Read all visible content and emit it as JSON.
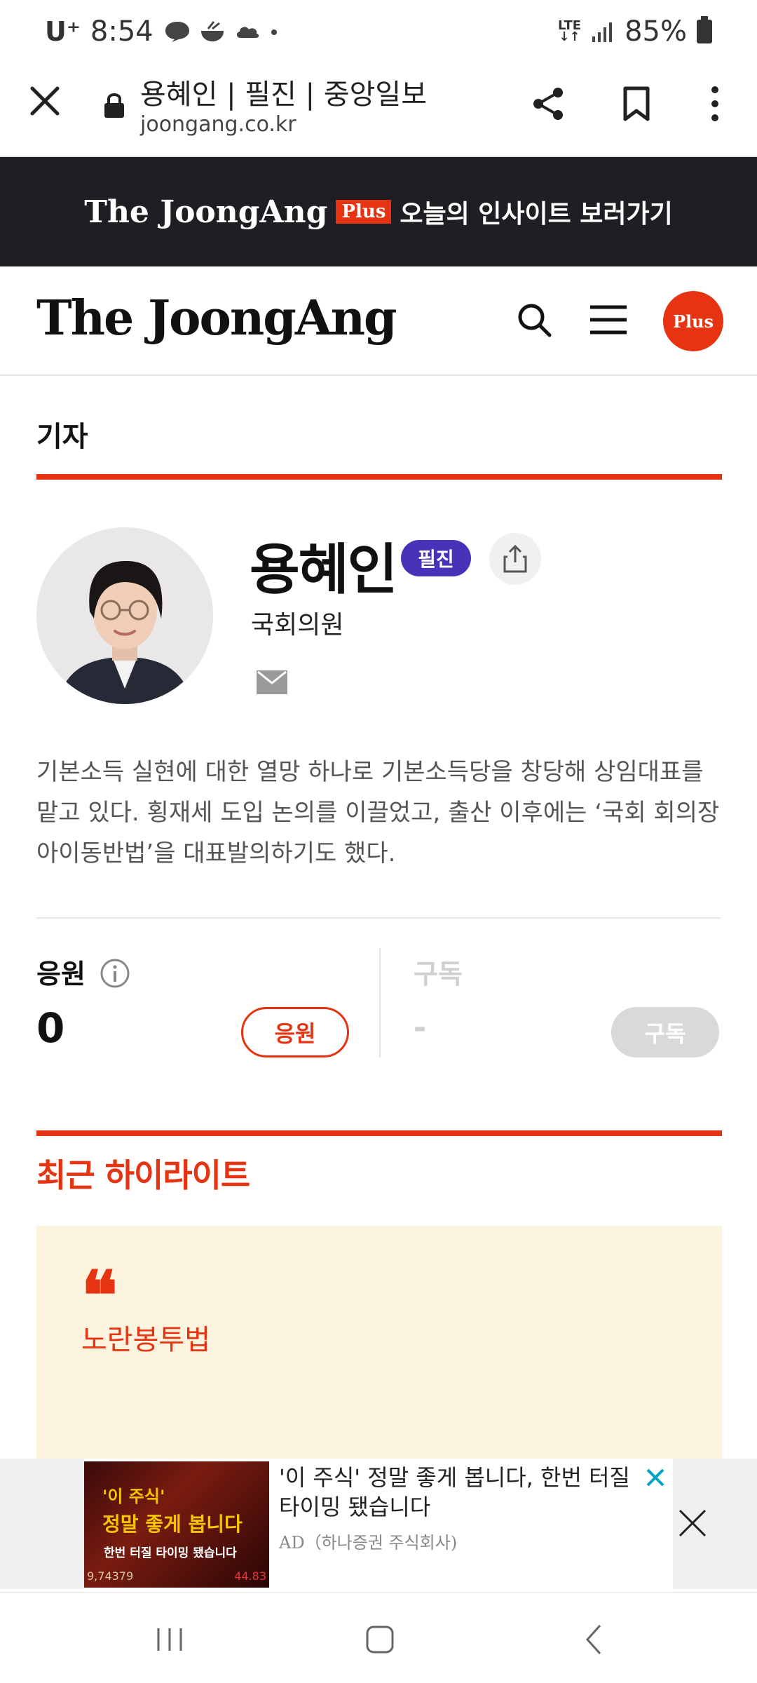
{
  "status_bar": {
    "carrier": "U⁺",
    "time": "8:54",
    "network": "LTE",
    "battery": "85%"
  },
  "browser": {
    "page_title": "용혜인 | 필진 | 중앙일보",
    "url": "joongang.co.kr"
  },
  "promo_banner": {
    "logo": "The JoongAng",
    "plus_tag": "Plus",
    "text": "오늘의 인사이트 보러가기"
  },
  "header": {
    "logo": "The JoongAng",
    "plus_button": "Plus"
  },
  "section_label": "기자",
  "reporter": {
    "name": "용혜인",
    "badge": "필진",
    "role": "국회의원",
    "bio": "기본소득 실현에 대한 열망 하나로 기본소득당을 창당해 상임대표를 맡고 있다. 횡재세 도입 논의를 이끌었고, 출산 이후에는 ‘국회 회의장 아이동반법’을 대표발의하기도 했다."
  },
  "stats": {
    "cheer_label": "응원",
    "cheer_value": "0",
    "cheer_button": "응원",
    "subscribe_label": "구독",
    "subscribe_value": "-",
    "subscribe_button": "구독"
  },
  "highlights": {
    "title": "최근 하이라이트",
    "quote_mark": "❝",
    "items": [
      {
        "text": "노란봉투법"
      }
    ]
  },
  "ad": {
    "image_line1": "'이 주식'",
    "image_line2": "정말 좋게 봅니다",
    "image_line3": "한번 터질 타이밍 됐습니다",
    "image_line4": "9,74379",
    "image_line5": "44.83",
    "headline": "'이 주식' 정말 좋게 봅니다, 한번 터질 타이밍 됐습니다",
    "sponsor": "AD（하나증권 주식회사)"
  },
  "colors": {
    "accent": "#e63312",
    "badge": "#4a32b8",
    "banner_bg": "#1f1f23",
    "highlight_bg": "#fdf4e0"
  }
}
